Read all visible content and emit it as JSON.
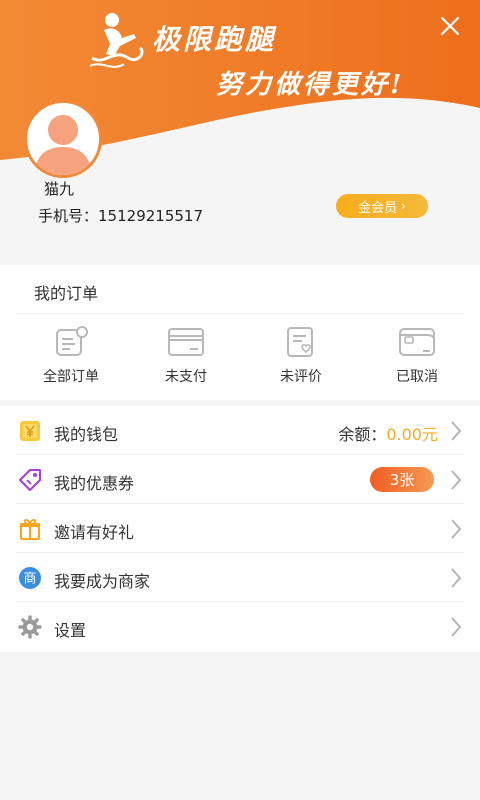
{
  "header": {
    "brand_title": "极限跑腿",
    "slogan": "努力做得更好!",
    "colors": {
      "primary": "#ef7424",
      "light": "#f7a04d"
    }
  },
  "profile": {
    "username": "猫九",
    "phone_label": "手机号：",
    "phone": "15129215517",
    "vip_label": "金会员",
    "vip_color": "#f8ad1c"
  },
  "orders": {
    "title": "我的订单",
    "items": [
      {
        "label": "全部订单",
        "icon": "order-list-icon"
      },
      {
        "label": "未支付",
        "icon": "card-icon"
      },
      {
        "label": "未评价",
        "icon": "review-icon"
      },
      {
        "label": "已取消",
        "icon": "wallet-icon"
      }
    ]
  },
  "menu": {
    "wallet": {
      "label": "我的钱包",
      "balance_label": "余额：",
      "balance_value": "0.00元",
      "icon": "yuan-icon"
    },
    "coupons": {
      "label": "我的优惠券",
      "count": "3张",
      "icon": "tag-icon"
    },
    "invite": {
      "label": "邀请有好礼",
      "icon": "gift-icon"
    },
    "merchant": {
      "label": "我要成为商家",
      "icon": "shop-icon",
      "glyph": "商"
    },
    "settings": {
      "label": "设置",
      "icon": "gear-icon"
    }
  }
}
